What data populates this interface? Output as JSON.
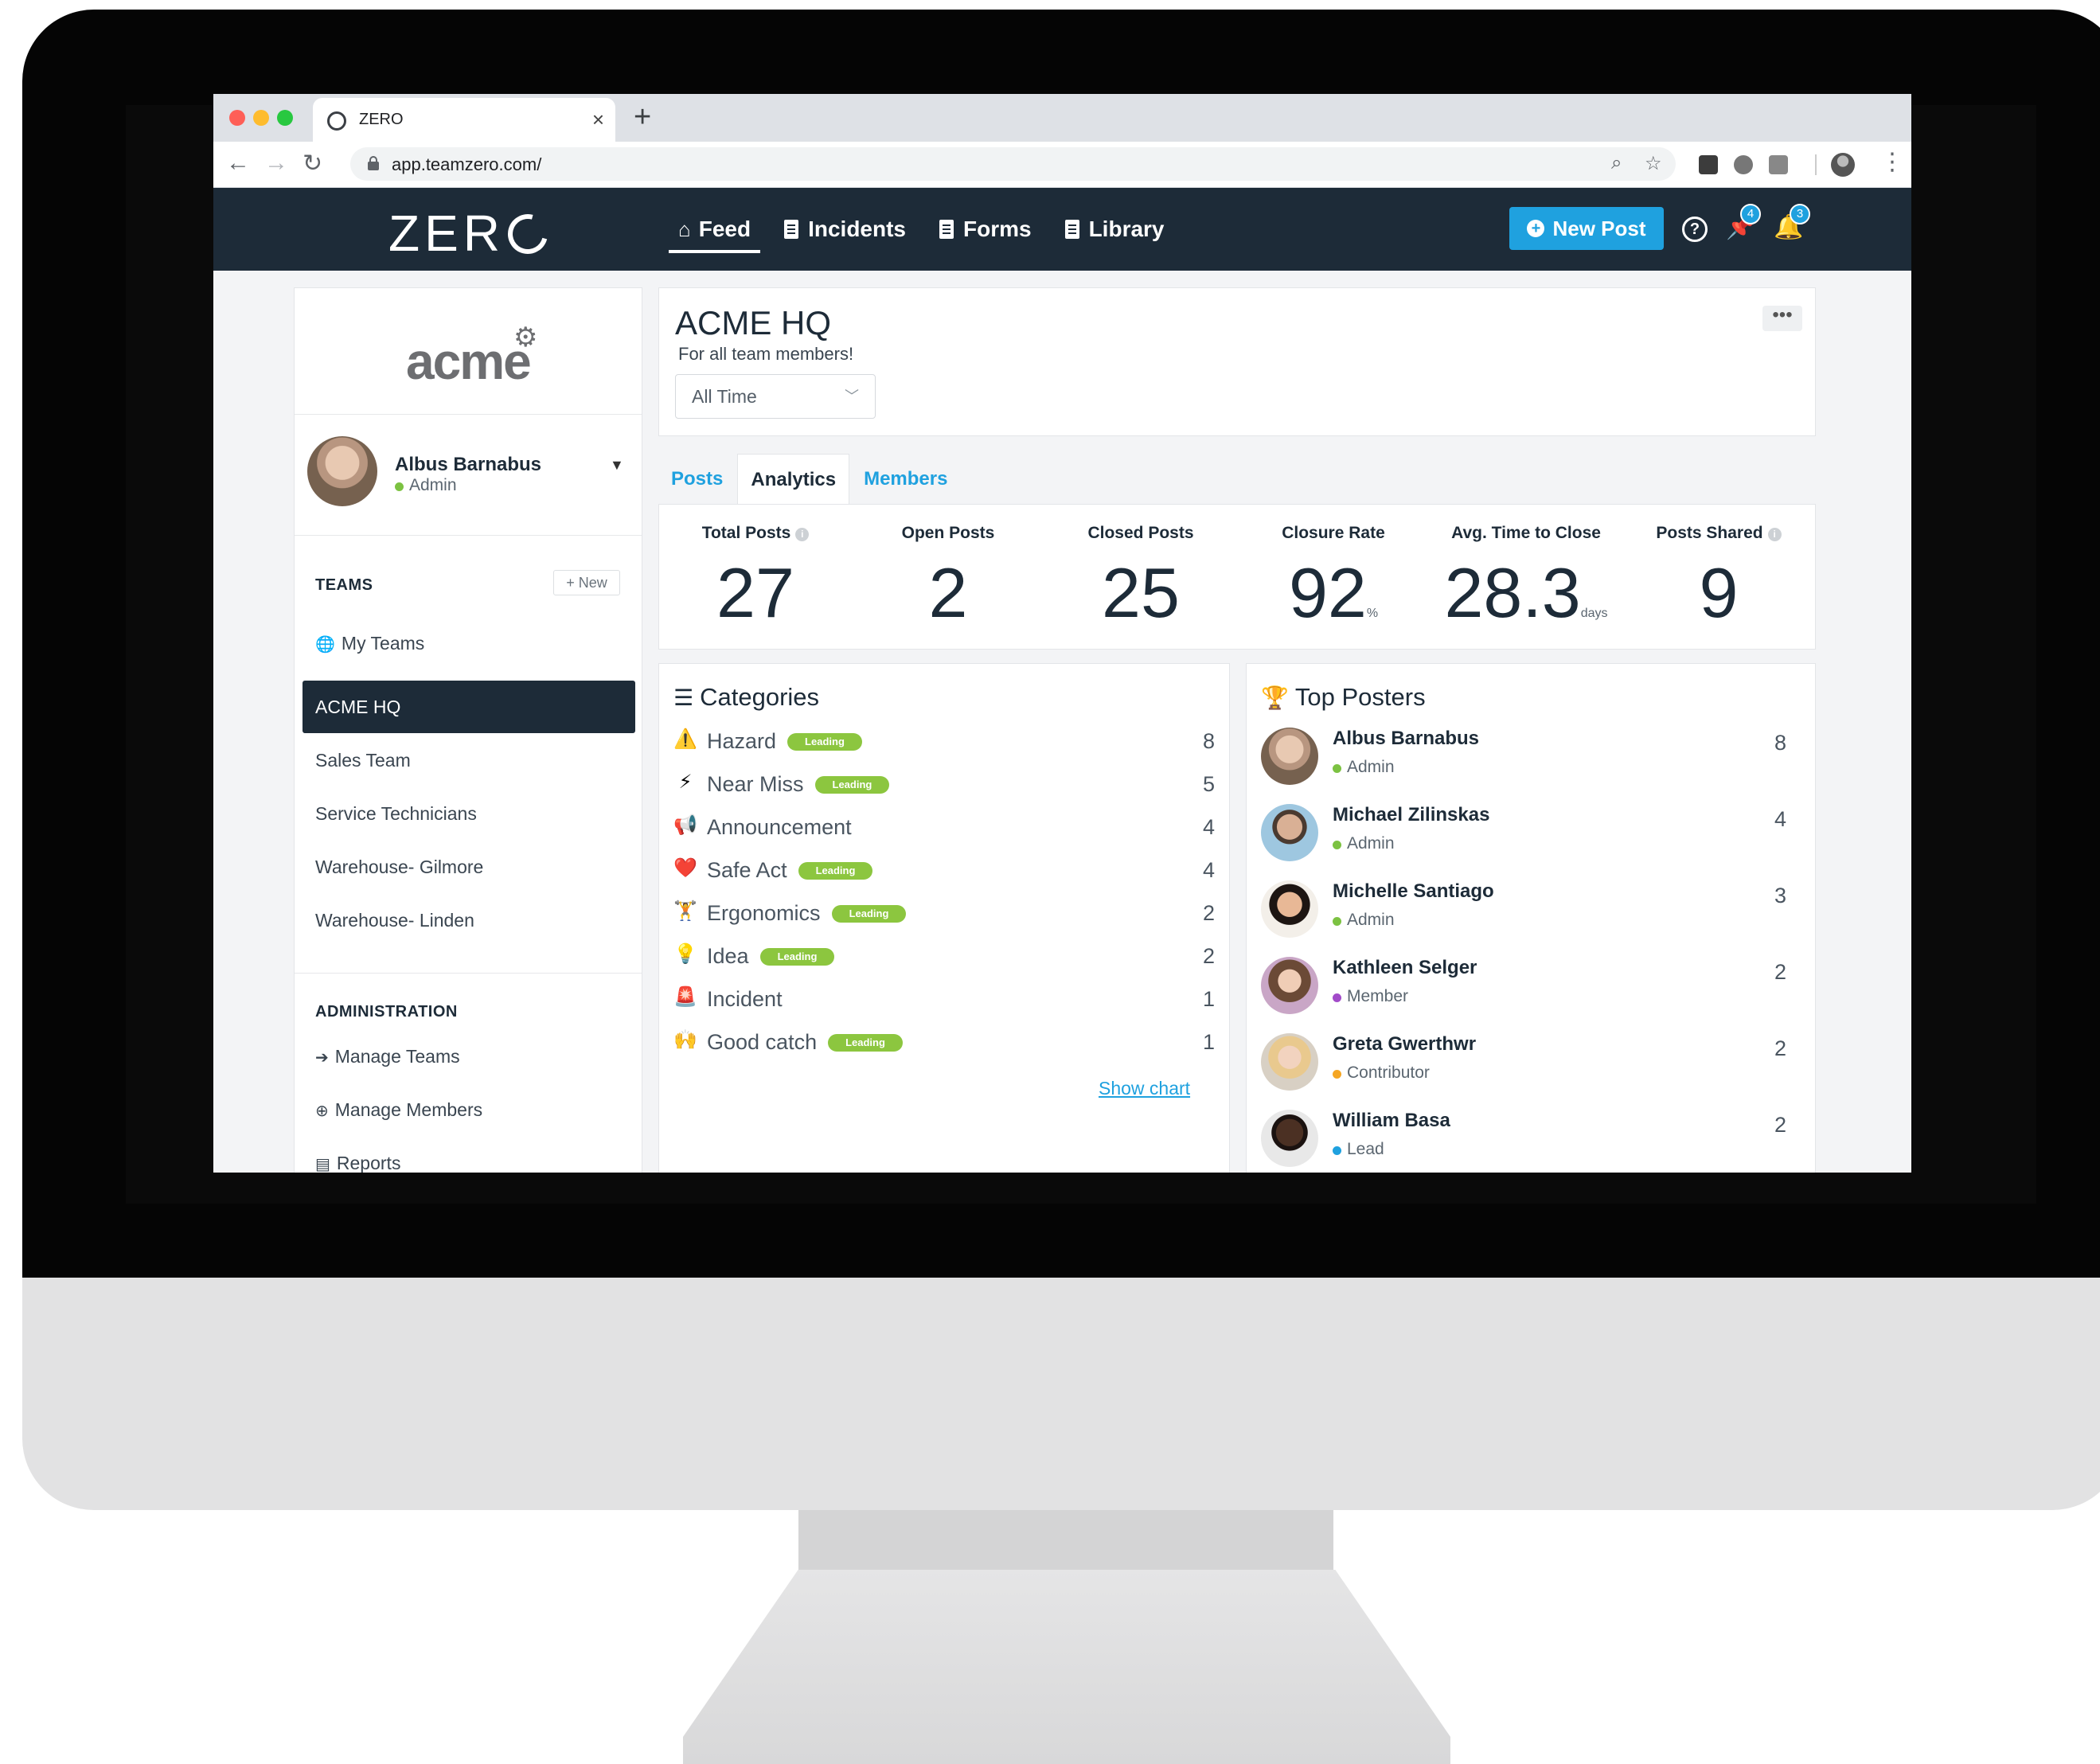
{
  "browser": {
    "tab_title": "ZERO",
    "url": "app.teamzero.com/"
  },
  "header": {
    "brand": "ZERO",
    "nav": [
      {
        "label": "Feed",
        "icon": "home-icon"
      },
      {
        "label": "Incidents",
        "icon": "clipboard-icon"
      },
      {
        "label": "Forms",
        "icon": "clipboard-icon"
      },
      {
        "label": "Library",
        "icon": "book-icon"
      }
    ],
    "new_post_label": "New Post",
    "pin_badge": "4",
    "bell_badge": "3",
    "accent_color": "#1fa1df",
    "bar_color": "#1d2b38"
  },
  "sidebar": {
    "org_logo": "acme",
    "user": {
      "name": "Albus Barnabus",
      "role": "Admin"
    },
    "teams_title": "TEAMS",
    "new_team_label": "+ New",
    "my_teams_label": "My Teams",
    "teams": [
      "ACME HQ",
      "Sales Team",
      "Service Technicians",
      "Warehouse- Gilmore",
      "Warehouse- Linden"
    ],
    "admin_title": "ADMINISTRATION",
    "admin_items": [
      "Manage Teams",
      "Manage Members",
      "Reports"
    ]
  },
  "team": {
    "title": "ACME HQ",
    "subtitle": "For all team members!",
    "time_filter": "All Time",
    "more_label": "•••"
  },
  "tabs": [
    "Posts",
    "Analytics",
    "Members"
  ],
  "stats": [
    {
      "label": "Total Posts",
      "value": "27",
      "unit": "",
      "info": true
    },
    {
      "label": "Open Posts",
      "value": "2",
      "unit": "",
      "info": false
    },
    {
      "label": "Closed Posts",
      "value": "25",
      "unit": "",
      "info": false
    },
    {
      "label": "Closure Rate",
      "value": "92",
      "unit": "%",
      "info": false
    },
    {
      "label": "Avg. Time to Close",
      "value": "28.3",
      "unit": "days",
      "info": false
    },
    {
      "label": "Posts Shared",
      "value": "9",
      "unit": "",
      "info": true
    }
  ],
  "categories": {
    "title": "Categories",
    "badge_label": "Leading",
    "items": [
      {
        "name": "Hazard",
        "icon": "⚠️",
        "count": "8",
        "leading": true
      },
      {
        "name": "Near Miss",
        "icon": "⚡",
        "count": "5",
        "leading": true
      },
      {
        "name": "Announcement",
        "icon": "📢",
        "count": "4",
        "leading": false
      },
      {
        "name": "Safe Act",
        "icon": "❤️",
        "count": "4",
        "leading": true
      },
      {
        "name": "Ergonomics",
        "icon": "🏋",
        "count": "2",
        "leading": true
      },
      {
        "name": "Idea",
        "icon": "💡",
        "count": "2",
        "leading": true
      },
      {
        "name": "Incident",
        "icon": "🚨",
        "count": "1",
        "leading": false
      },
      {
        "name": "Good catch",
        "icon": "🙌",
        "count": "1",
        "leading": true
      }
    ],
    "show_chart_label": "Show chart"
  },
  "top_posters": {
    "title": "Top Posters",
    "items": [
      {
        "name": "Albus Barnabus",
        "role": "Admin",
        "count": "8",
        "role_color": "#7cc242"
      },
      {
        "name": "Michael Zilinskas",
        "role": "Admin",
        "count": "4",
        "role_color": "#7cc242"
      },
      {
        "name": "Michelle Santiago",
        "role": "Admin",
        "count": "3",
        "role_color": "#7cc242"
      },
      {
        "name": "Kathleen Selger",
        "role": "Member",
        "count": "2",
        "role_color": "#a24bc9"
      },
      {
        "name": "Greta Gwerthwr",
        "role": "Contributor",
        "count": "2",
        "role_color": "#f5a623"
      },
      {
        "name": "William Basa",
        "role": "Lead",
        "count": "2",
        "role_color": "#1fa1df"
      }
    ]
  }
}
